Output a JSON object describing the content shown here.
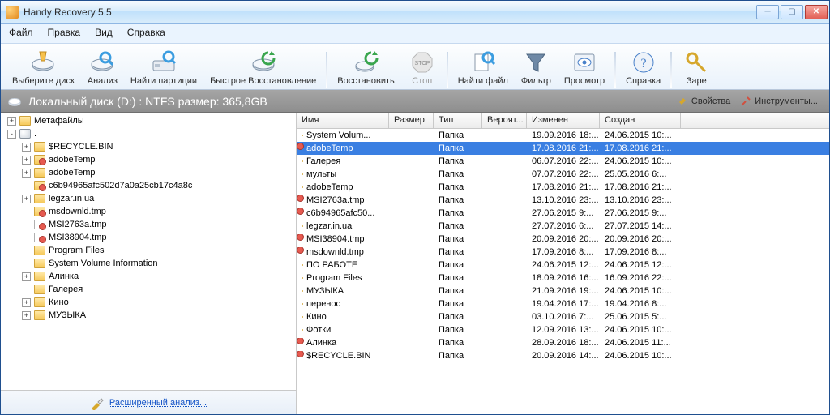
{
  "window": {
    "title": "Handy Recovery 5.5"
  },
  "menu": {
    "file": "Файл",
    "edit": "Правка",
    "view": "Вид",
    "help": "Справка"
  },
  "toolbar": {
    "select_disk": "Выберите диск",
    "analyze": "Анализ",
    "find_partitions": "Найти партиции",
    "quick_recovery": "Быстрое Восстановление",
    "recover": "Восстановить",
    "stop": "Стоп",
    "find_file": "Найти файл",
    "filter": "Фильтр",
    "preview": "Просмотр",
    "help": "Справка",
    "extra": "Заре"
  },
  "pathbar": {
    "text": "Локальный диск (D:) : NTFS размер: 365,8GB",
    "properties": "Свойства",
    "tools": "Инструменты..."
  },
  "tree": {
    "items": [
      {
        "depth": 0,
        "pm": "+",
        "icon": "folder",
        "label": "Метафайлы"
      },
      {
        "depth": 0,
        "pm": "-",
        "icon": "disk",
        "label": "."
      },
      {
        "depth": 1,
        "pm": "+",
        "icon": "folder",
        "label": "$RECYCLE.BIN"
      },
      {
        "depth": 1,
        "pm": "+",
        "icon": "folder.del",
        "label": "adobeTemp"
      },
      {
        "depth": 1,
        "pm": "+",
        "icon": "folder",
        "label": "adobeTemp"
      },
      {
        "depth": 1,
        "pm": "",
        "icon": "folder.del",
        "label": "c6b94965afc502d7a0a25cb17c4a8c"
      },
      {
        "depth": 1,
        "pm": "+",
        "icon": "folder",
        "label": "legzar.in.ua"
      },
      {
        "depth": 1,
        "pm": "",
        "icon": "folder.del",
        "label": "msdownld.tmp"
      },
      {
        "depth": 1,
        "pm": "",
        "icon": "file.del",
        "label": "MSI2763a.tmp"
      },
      {
        "depth": 1,
        "pm": "",
        "icon": "file.del",
        "label": "MSI38904.tmp"
      },
      {
        "depth": 1,
        "pm": "",
        "icon": "folder",
        "label": "Program Files"
      },
      {
        "depth": 1,
        "pm": "",
        "icon": "folder",
        "label": "System Volume Information"
      },
      {
        "depth": 1,
        "pm": "+",
        "icon": "folder",
        "label": "Алинка"
      },
      {
        "depth": 1,
        "pm": "",
        "icon": "folder",
        "label": "Галерея"
      },
      {
        "depth": 1,
        "pm": "+",
        "icon": "folder",
        "label": "Кино"
      },
      {
        "depth": 1,
        "pm": "+",
        "icon": "folder",
        "label": "МУЗЫКА"
      }
    ],
    "advanced": "Расширенный анализ..."
  },
  "list": {
    "headers": {
      "name": "Имя",
      "size": "Размер",
      "type": "Тип",
      "prob": "Вероят...",
      "mod": "Изменен",
      "crt": "Создан"
    },
    "rows": [
      {
        "icon": "folder",
        "name": "System Volum...",
        "type": "Папка",
        "mod": "19.09.2016 18:...",
        "crt": "24.06.2015 10:..."
      },
      {
        "icon": "folder.del",
        "name": "adobeTemp",
        "type": "Папка",
        "mod": "17.08.2016 21:...",
        "crt": "17.08.2016 21:...",
        "selected": true
      },
      {
        "icon": "folder",
        "name": "Галерея",
        "type": "Папка",
        "mod": "06.07.2016 22:...",
        "crt": "24.06.2015 10:..."
      },
      {
        "icon": "folder",
        "name": "мульты",
        "type": "Папка",
        "mod": "07.07.2016 22:...",
        "crt": "25.05.2016 6:..."
      },
      {
        "icon": "folder",
        "name": "adobeTemp",
        "type": "Папка",
        "mod": "17.08.2016 21:...",
        "crt": "17.08.2016 21:..."
      },
      {
        "icon": "file.del",
        "name": "MSI2763a.tmp",
        "type": "Папка",
        "mod": "13.10.2016 23:...",
        "crt": "13.10.2016 23:..."
      },
      {
        "icon": "folder.del",
        "name": "c6b94965afc50...",
        "type": "Папка",
        "mod": "27.06.2015 9:...",
        "crt": "27.06.2015 9:..."
      },
      {
        "icon": "folder",
        "name": "legzar.in.ua",
        "type": "Папка",
        "mod": "27.07.2016 6:...",
        "crt": "27.07.2015 14:..."
      },
      {
        "icon": "file.del",
        "name": "MSI38904.tmp",
        "type": "Папка",
        "mod": "20.09.2016 20:...",
        "crt": "20.09.2016 20:..."
      },
      {
        "icon": "folder.del",
        "name": "msdownld.tmp",
        "type": "Папка",
        "mod": "17.09.2016 8:...",
        "crt": "17.09.2016 8:..."
      },
      {
        "icon": "folder",
        "name": "ПО РАБОТЕ",
        "type": "Папка",
        "mod": "24.06.2015 12:...",
        "crt": "24.06.2015 12:..."
      },
      {
        "icon": "folder",
        "name": "Program Files",
        "type": "Папка",
        "mod": "18.09.2016 16:...",
        "crt": "16.09.2016 22:..."
      },
      {
        "icon": "folder",
        "name": "МУЗЫКА",
        "type": "Папка",
        "mod": "21.09.2016 19:...",
        "crt": "24.06.2015 10:..."
      },
      {
        "icon": "folder",
        "name": "перенос",
        "type": "Папка",
        "mod": "19.04.2016 17:...",
        "crt": "19.04.2016 8:..."
      },
      {
        "icon": "folder",
        "name": "Кино",
        "type": "Папка",
        "mod": "03.10.2016 7:...",
        "crt": "25.06.2015 5:..."
      },
      {
        "icon": "folder",
        "name": "Фотки",
        "type": "Папка",
        "mod": "12.09.2016 13:...",
        "crt": "24.06.2015 10:..."
      },
      {
        "icon": "folder.del",
        "name": "Алинка",
        "type": "Папка",
        "mod": "28.09.2016 18:...",
        "crt": "24.06.2015 11:..."
      },
      {
        "icon": "folder.del",
        "name": "$RECYCLE.BIN",
        "type": "Папка",
        "mod": "20.09.2016 14:...",
        "crt": "24.06.2015 10:..."
      }
    ]
  }
}
